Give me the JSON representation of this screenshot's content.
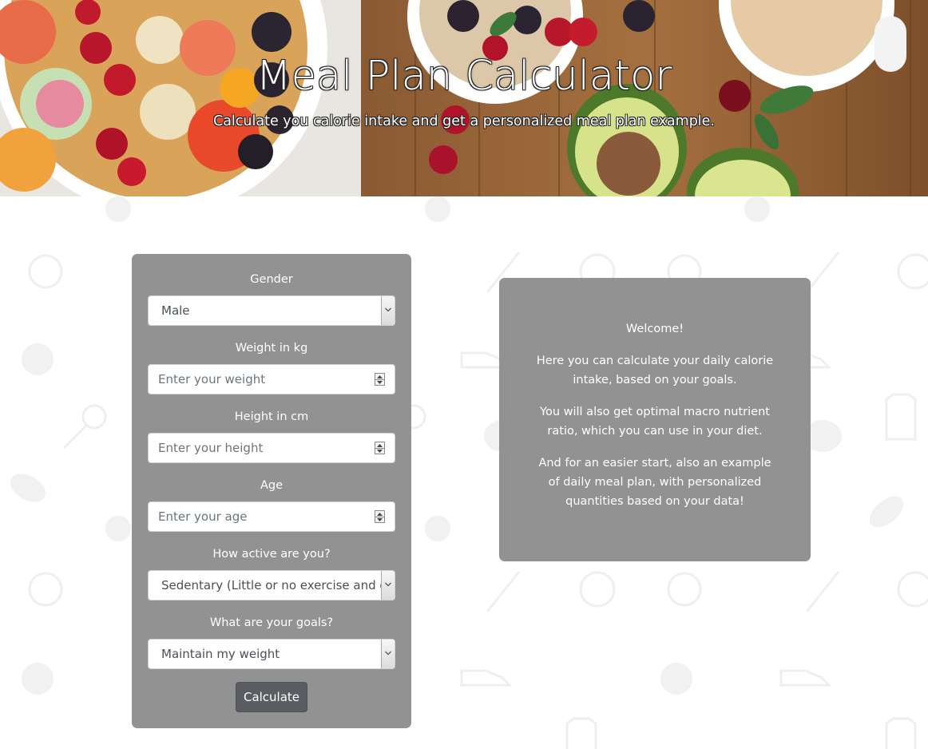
{
  "hero": {
    "title": "Meal Plan Calculator",
    "subtitle": "Calculate you calorie intake and get a personalized meal plan example."
  },
  "form": {
    "gender_label": "Gender",
    "gender_value": "Male",
    "weight_label": "Weight in kg",
    "weight_placeholder": "Enter your weight",
    "height_label": "Height in cm",
    "height_placeholder": "Enter your height",
    "age_label": "Age",
    "age_placeholder": "Enter your age",
    "activity_label": "How active are you?",
    "activity_value": "Sedentary (Little or no exercise and desk job)",
    "goal_label": "What are your goals?",
    "goal_value": "Maintain my weight",
    "calculate_label": "Calculate"
  },
  "welcome": {
    "heading": "Welcome!",
    "p1": "Here you can calculate your daily calorie intake, based on your goals.",
    "p2": "You will also get optimal macro nutrient ratio, which you can use in your diet.",
    "p3": "And for an easier start, also an example of daily meal plan, with personalized quantities based on your data!"
  },
  "colors": {
    "panel": "#929292",
    "button": "#5a5d62",
    "pattern_icon": "#f1f1f1"
  }
}
